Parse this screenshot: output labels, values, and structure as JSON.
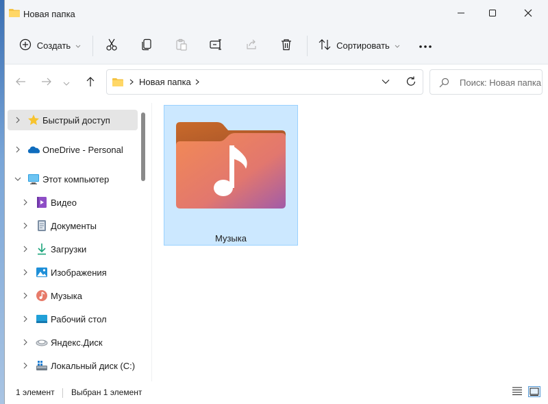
{
  "window": {
    "title": "Новая папка",
    "title_icon": "folder-icon"
  },
  "window_controls": {
    "minimize_icon": "minimize-icon",
    "maximize_icon": "maximize-icon",
    "close_icon": "close-icon"
  },
  "toolbar": {
    "new_label": "Создать",
    "new_icon": "plus-circle-icon",
    "cut_icon": "scissors-icon",
    "copy_icon": "copy-icon",
    "paste_icon": "paste-icon",
    "rename_icon": "rename-icon",
    "share_icon": "share-icon",
    "delete_icon": "trash-icon",
    "sort_label": "Сортировать",
    "sort_icon": "sort-icon",
    "more_icon": "more-icon"
  },
  "navigation": {
    "back_icon": "arrow-left-icon",
    "forward_icon": "arrow-right-icon",
    "recent_icon": "chevron-down-icon",
    "up_icon": "arrow-up-icon"
  },
  "address": {
    "path": "Новая папка",
    "folder_icon": "folder-icon",
    "dropdown_icon": "chevron-down-icon",
    "refresh_icon": "refresh-icon"
  },
  "search": {
    "placeholder": "Поиск: Новая папка",
    "icon": "search-icon"
  },
  "sidebar": {
    "items": [
      {
        "label": "Быстрый доступ",
        "icon": "star-icon",
        "selected": true
      },
      {
        "label": "OneDrive - Personal",
        "icon": "cloud-icon"
      },
      {
        "label": "Этот компьютер",
        "icon": "monitor-icon",
        "expanded": true
      },
      {
        "label": "Видео",
        "icon": "video-icon"
      },
      {
        "label": "Документы",
        "icon": "document-icon"
      },
      {
        "label": "Загрузки",
        "icon": "download-icon"
      },
      {
        "label": "Изображения",
        "icon": "image-icon"
      },
      {
        "label": "Музыка",
        "icon": "music-icon"
      },
      {
        "label": "Рабочий стол",
        "icon": "desktop-icon"
      },
      {
        "label": "Яндекс.Диск",
        "icon": "disk-icon"
      },
      {
        "label": "Локальный диск (C:)",
        "icon": "drive-icon"
      }
    ]
  },
  "content": {
    "items": [
      {
        "name": "Музыка",
        "icon": "music-folder-icon",
        "selected": true
      }
    ]
  },
  "status": {
    "count": "1 элемент",
    "selection": "Выбран 1 элемент",
    "details_view_icon": "details-view-icon",
    "tiles_view_icon": "tiles-view-icon"
  },
  "colors": {
    "accent": "#0067c0",
    "selection_fill": "#cce8ff",
    "selection_border": "#99d1ff",
    "folder_yellow": "#f5c343",
    "folder_music_front": "#e8785c",
    "folder_music_back": "#c96a2a"
  }
}
